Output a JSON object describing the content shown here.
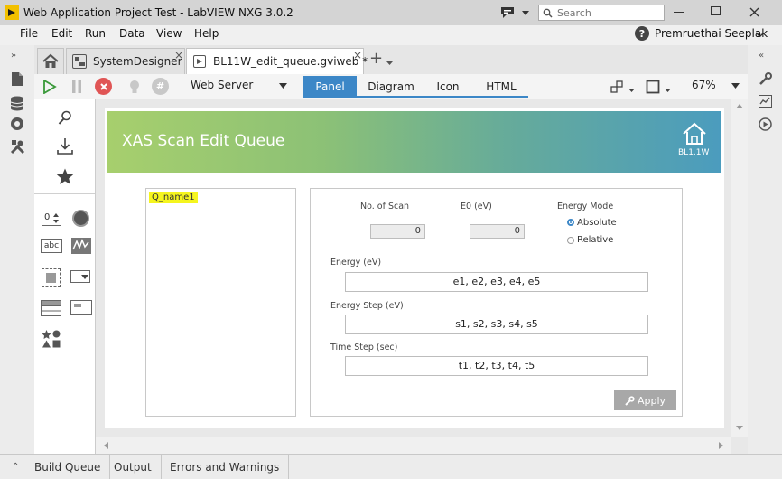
{
  "window": {
    "title": "Web Application Project Test - LabVIEW NXG 3.0.2",
    "search_placeholder": "Search",
    "user": "Premruethai Seeplak"
  },
  "menu": [
    "File",
    "Edit",
    "Run",
    "Data",
    "View",
    "Help"
  ],
  "tabs": [
    {
      "label": "SystemDesigner",
      "close": "×"
    },
    {
      "label": "BL11W_edit_queue.gviweb *",
      "close": "×"
    }
  ],
  "add_tab": "+",
  "toolbar": {
    "target": "Web Server",
    "view_tabs": [
      "Panel",
      "Diagram",
      "Icon",
      "HTML"
    ],
    "active_view": "Panel",
    "zoom": "67%"
  },
  "panel": {
    "header_title": "XAS Scan Edit Queue",
    "logo_text": "BL1.1W",
    "queue_items": [
      "Q_name1"
    ],
    "no_of_scan_label": "No. of Scan",
    "no_of_scan_value": "0",
    "e0_label": "E0 (eV)",
    "e0_value": "0",
    "energy_mode_label": "Energy Mode",
    "energy_mode_options": [
      "Absolute",
      "Relative"
    ],
    "energy_mode_selected": "Absolute",
    "energy_label": "Energy (eV)",
    "energy_value": "e1, e2, e3, e4, e5",
    "energy_step_label": "Energy Step (eV)",
    "energy_step_value": "s1, s2, s3, s4, s5",
    "time_step_label": "Time Step (sec)",
    "time_step_value": "t1, t2, t3, t4, t5",
    "apply_label": "Apply"
  },
  "palette_numeric_glyph": "0",
  "palette_string_glyph": "abc",
  "bottom_tabs": [
    "Build Queue",
    "Output",
    "Errors and Warnings"
  ],
  "colors": {
    "accent": "#3c87c7",
    "banner_start": "#a7cf6d",
    "banner_end": "#4b9cbe",
    "highlight": "#f5f51e"
  }
}
